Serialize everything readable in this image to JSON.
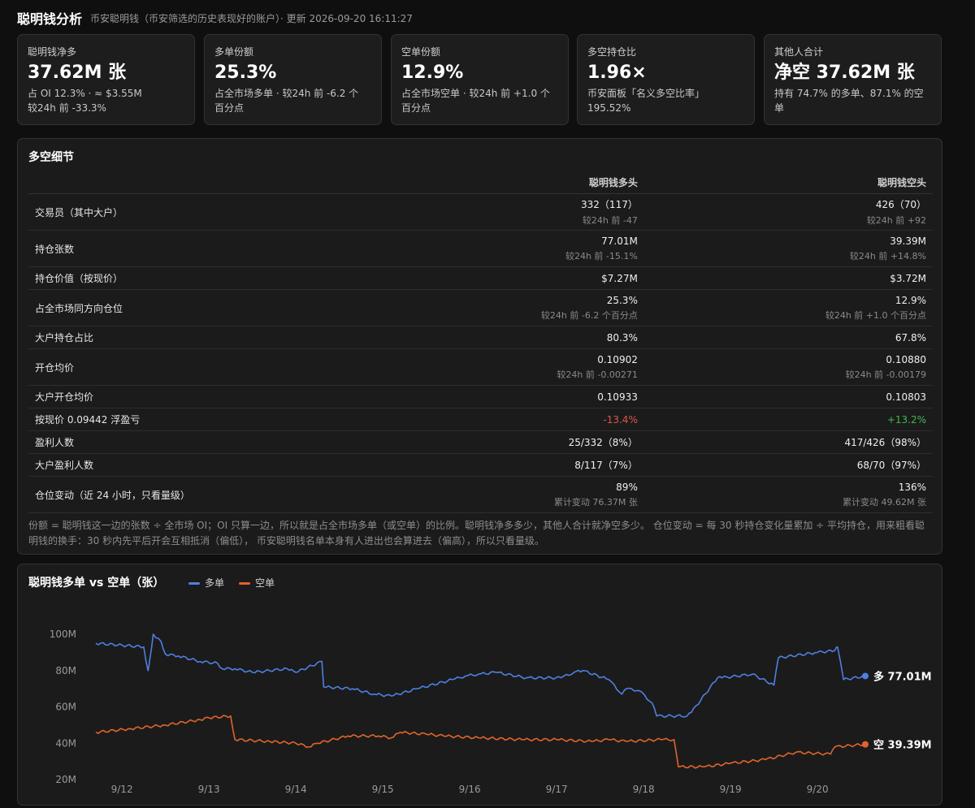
{
  "header": {
    "title": "聪明钱分析",
    "subtitle": "币安聪明钱（币安筛选的历史表现好的账户）· 更新 2026-09-20 16:11:27"
  },
  "cards": [
    {
      "label": "聪明钱净多",
      "value": "37.62M 张",
      "desc1": "占 OI 12.3% · ≈ $3.55M",
      "desc2": "较24h 前 -33.3%"
    },
    {
      "label": "多单份额",
      "value": "25.3%",
      "desc1": "占全市场多单 · 较24h 前 -6.2 个",
      "desc2": "百分点"
    },
    {
      "label": "空单份额",
      "value": "12.9%",
      "desc1": "占全市场空单 · 较24h 前 +1.0 个",
      "desc2": "百分点"
    },
    {
      "label": "多空持仓比",
      "value": "1.96×",
      "desc1": "币安面板「名义多空比率」",
      "desc2": "195.52%"
    },
    {
      "label": "其他人合计",
      "value": "净空 37.62M 张",
      "desc1": "持有 74.7% 的多单、87.1% 的空",
      "desc2": "单"
    }
  ],
  "detail": {
    "title": "多空细节",
    "col_long": "聪明钱多头",
    "col_short": "聪明钱空头",
    "rows": [
      {
        "label": "交易员（其中大户）",
        "long": "332（117）",
        "long_sub": "较24h 前 -47",
        "short": "426（70）",
        "short_sub": "较24h 前 +92"
      },
      {
        "label": "持仓张数",
        "long": "77.01M",
        "long_sub": "较24h 前 -15.1%",
        "short": "39.39M",
        "short_sub": "较24h 前 +14.8%"
      },
      {
        "label": "持仓价值（按现价）",
        "long": "$7.27M",
        "long_sub": "",
        "short": "$3.72M",
        "short_sub": ""
      },
      {
        "label": "占全市场同方向仓位",
        "long": "25.3%",
        "long_sub": "较24h 前 -6.2 个百分点",
        "short": "12.9%",
        "short_sub": "较24h 前 +1.0 个百分点"
      },
      {
        "label": "大户持仓占比",
        "long": "80.3%",
        "long_sub": "",
        "short": "67.8%",
        "short_sub": ""
      },
      {
        "label": "开仓均价",
        "long": "0.10902",
        "long_sub": "较24h 前 -0.00271",
        "short": "0.10880",
        "short_sub": "较24h 前 -0.00179"
      },
      {
        "label": "大户开仓均价",
        "long": "0.10933",
        "long_sub": "",
        "short": "0.10803",
        "short_sub": ""
      },
      {
        "label": "按现价 0.09442 浮盈亏",
        "long": "-13.4%",
        "long_sub": "",
        "short": "+13.2%",
        "short_sub": "",
        "colored": true
      },
      {
        "label": "盈利人数",
        "long": "25/332（8%）",
        "long_sub": "",
        "short": "417/426（98%）",
        "short_sub": ""
      },
      {
        "label": "大户盈利人数",
        "long": "8/117（7%）",
        "long_sub": "",
        "short": "68/70（97%）",
        "short_sub": ""
      },
      {
        "label": "仓位变动（近 24 小时，只看量级）",
        "long": "89%",
        "long_sub": "累计变动 76.37M 张",
        "short": "136%",
        "short_sub": "累计变动 49.62M 张"
      }
    ],
    "note": "份额 = 聪明钱这一边的张数 ÷ 全市场 OI；OI 只算一边，所以就是占全市场多单（或空单）的比例。聪明钱净多多少，其他人合计就净空多少。 仓位变动 = 每 30 秒持仓变化量累加 ÷ 平均持仓，用来粗看聪明钱的换手：30 秒内先平后开会互相抵消（偏低）， 币安聪明钱名单本身有人进出也会算进去（偏高），所以只看量级。"
  },
  "chart_header": {
    "title": "聪明钱多单 vs 空单（张）",
    "legend_long": "多单",
    "legend_short": "空单"
  },
  "chart_data": {
    "type": "line",
    "title": "聪明钱多单 vs 空单（张）",
    "x_ticks": [
      "9/12",
      "9/13",
      "9/14",
      "9/15",
      "9/16",
      "9/17",
      "9/18",
      "9/19",
      "9/20"
    ],
    "y_ticks": [
      "20M",
      "40M",
      "60M",
      "80M",
      "100M"
    ],
    "ylim": [
      20,
      100
    ],
    "xlim": [
      0,
      8.85
    ],
    "grid": false,
    "legend": "top-left",
    "colors": {
      "long": "#4f7fe0",
      "short": "#e0642a"
    },
    "series": [
      {
        "name": "多单",
        "end_label": "多 77.01M",
        "x": [
          0,
          0.55,
          0.6,
          0.62,
          0.66,
          0.75,
          0.8,
          0.95,
          1.2,
          1.4,
          1.45,
          1.6,
          1.8,
          2.2,
          2.3,
          2.6,
          2.62,
          2.95,
          3.2,
          3.4,
          3.7,
          4.1,
          4.25,
          4.4,
          4.6,
          4.95,
          5.35,
          5.5,
          5.6,
          5.9,
          6.05,
          6.1,
          6.25,
          6.4,
          6.45,
          6.8,
          6.85,
          7.15,
          7.2,
          7.55,
          7.8,
          7.85,
          8.3,
          8.5,
          8.53,
          8.6,
          8.85
        ],
        "y": [
          95,
          93,
          80,
          86,
          100,
          96,
          89,
          88,
          85,
          84,
          81,
          81,
          79,
          81,
          79,
          85,
          71,
          70,
          67,
          66,
          70,
          75,
          77,
          78,
          79,
          76,
          76,
          79,
          80,
          75,
          67,
          70,
          69,
          62,
          55,
          55,
          57,
          76,
          76,
          78,
          72,
          87,
          90,
          91,
          93,
          75,
          77.01
        ]
      },
      {
        "name": "空单",
        "end_label": "空 39.39M",
        "x": [
          0,
          0.4,
          0.8,
          1.2,
          1.3,
          1.55,
          1.6,
          2.0,
          2.3,
          2.45,
          2.55,
          2.9,
          3.25,
          3.4,
          3.5,
          3.8,
          4.0,
          4.4,
          4.9,
          5.3,
          5.7,
          5.9,
          6.1,
          6.5,
          6.65,
          6.7,
          7.0,
          7.3,
          7.7,
          8.05,
          8.45,
          8.5,
          8.85
        ],
        "y": [
          46,
          48,
          50,
          53,
          54,
          55,
          42,
          41,
          40,
          38,
          40,
          44,
          44,
          43,
          46,
          45,
          44,
          43,
          42,
          42,
          41,
          42,
          41,
          42,
          42,
          27,
          27,
          29,
          31,
          35,
          34,
          38,
          39.39
        ]
      }
    ]
  }
}
